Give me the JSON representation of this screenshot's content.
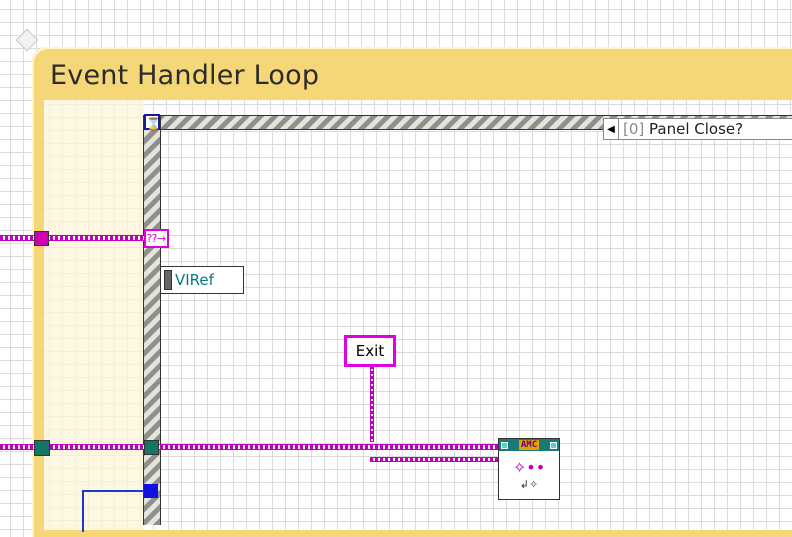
{
  "loop": {
    "title": "Event Handler Loop"
  },
  "event_case": {
    "index_label": "[0]",
    "case_label": "Panel Close?",
    "selector_arrow_glyph": "◀",
    "hourglass_glyph": "⌛"
  },
  "nodes": {
    "viref_label": "VIRef",
    "exit_constant": "Exit",
    "reg_events_glyph": "⁇→",
    "amc": {
      "badge": "AMC",
      "icon_top": "✧••",
      "icon_bottom": "↲✧"
    }
  },
  "colors": {
    "loop_frame": "#f6d777",
    "wire_pink": "#c000c0",
    "wire_teal": "#117766",
    "terminal_blue": "#1010e0",
    "viref_text": "#0a7b7b"
  }
}
